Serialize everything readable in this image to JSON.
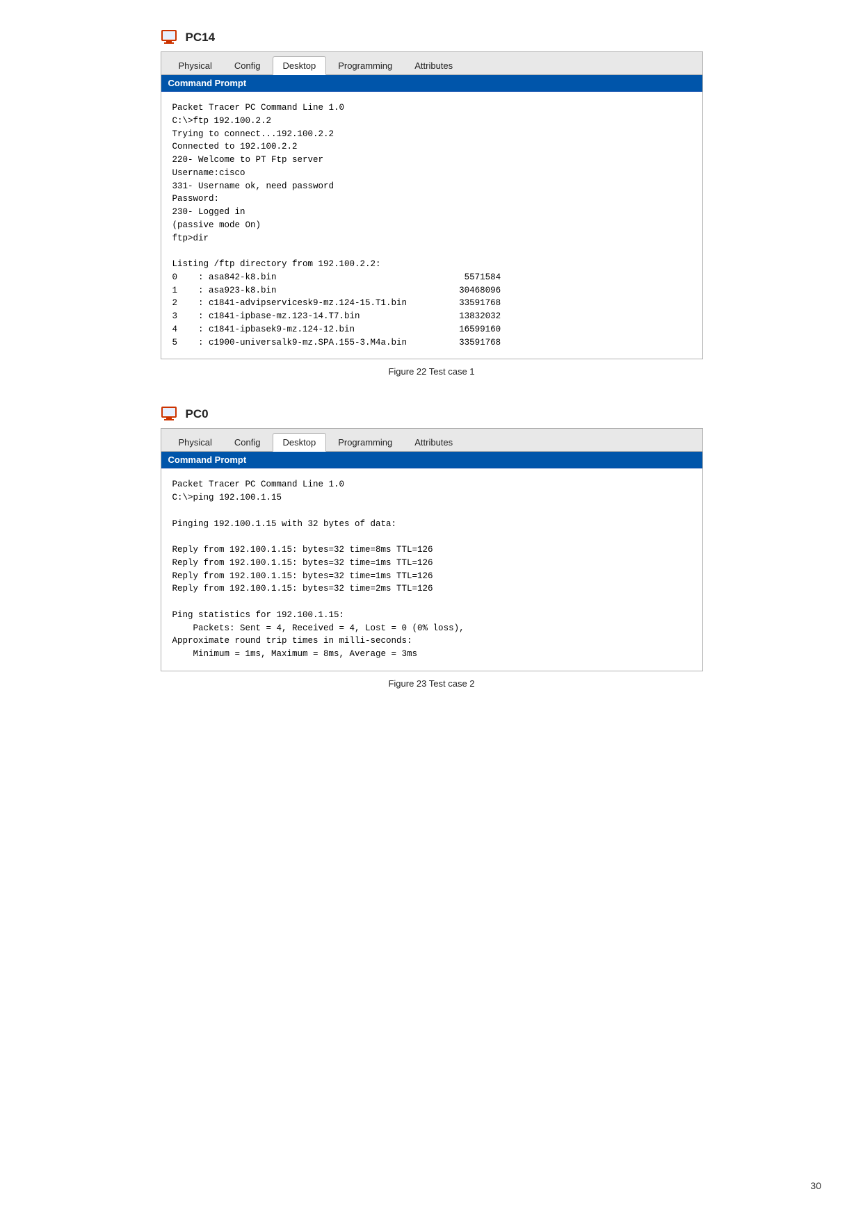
{
  "page": {
    "number": "30"
  },
  "figure1": {
    "device_name": "PC14",
    "caption": "Figure 22 Test case 1",
    "tabs": [
      {
        "label": "Physical",
        "active": false
      },
      {
        "label": "Config",
        "active": false
      },
      {
        "label": "Desktop",
        "active": true
      },
      {
        "label": "Programming",
        "active": false
      },
      {
        "label": "Attributes",
        "active": false
      }
    ],
    "command_prompt_label": "Command Prompt",
    "terminal_text": "Packet Tracer PC Command Line 1.0\nC:\\>ftp 192.100.2.2\nTrying to connect...192.100.2.2\nConnected to 192.100.2.2\n220- Welcome to PT Ftp server\nUsername:cisco\n331- Username ok, need password\nPassword:\n230- Logged in\n(passive mode On)\nftp>dir\n\nListing /ftp directory from 192.100.2.2:\n0    : asa842-k8.bin                                    5571584\n1    : asa923-k8.bin                                   30468096\n2    : c1841-advipservicesk9-mz.124-15.T1.bin          33591768\n3    : c1841-ipbase-mz.123-14.T7.bin                   13832032\n4    : c1841-ipbasek9-mz.124-12.bin                    16599160\n5    : c1900-universalk9-mz.SPA.155-3.M4a.bin          33591768"
  },
  "figure2": {
    "device_name": "PC0",
    "caption": "Figure 23 Test case 2",
    "tabs": [
      {
        "label": "Physical",
        "active": false
      },
      {
        "label": "Config",
        "active": false
      },
      {
        "label": "Desktop",
        "active": true
      },
      {
        "label": "Programming",
        "active": false
      },
      {
        "label": "Attributes",
        "active": false
      }
    ],
    "command_prompt_label": "Command Prompt",
    "terminal_text": "Packet Tracer PC Command Line 1.0\nC:\\>ping 192.100.1.15\n\nPinging 192.100.1.15 with 32 bytes of data:\n\nReply from 192.100.1.15: bytes=32 time=8ms TTL=126\nReply from 192.100.1.15: bytes=32 time=1ms TTL=126\nReply from 192.100.1.15: bytes=32 time=1ms TTL=126\nReply from 192.100.1.15: bytes=32 time=2ms TTL=126\n\nPing statistics for 192.100.1.15:\n    Packets: Sent = 4, Received = 4, Lost = 0 (0% loss),\nApproximate round trip times in milli-seconds:\n    Minimum = 1ms, Maximum = 8ms, Average = 3ms"
  }
}
